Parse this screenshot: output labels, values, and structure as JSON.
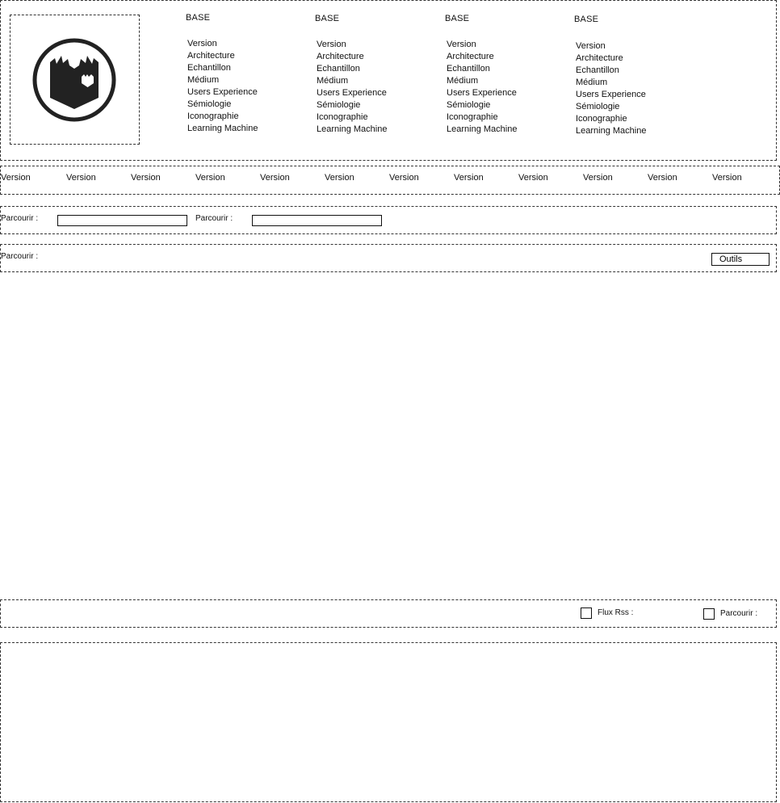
{
  "header": {
    "logo": {
      "icon": "book-shield-logo-icon",
      "color": "#222222"
    },
    "menus": [
      {
        "title": "BASE",
        "items": [
          "Version",
          "Architecture",
          "Echantillon",
          "Médium",
          "Users Experience",
          "Sémiologie",
          "Iconographie",
          "Learning Machine"
        ]
      },
      {
        "title": "BASE",
        "items": [
          "Version",
          "Architecture",
          "Echantillon",
          "Médium",
          "Users Experience",
          "Sémiologie",
          "Iconographie",
          "Learning Machine"
        ]
      },
      {
        "title": "BASE",
        "items": [
          "Version",
          "Architecture",
          "Echantillon",
          "Médium",
          "Users Experience",
          "Sémiologie",
          "Iconographie",
          "Learning Machine"
        ]
      },
      {
        "title": "BASE",
        "items": [
          "Version",
          "Architecture",
          "Echantillon",
          "Médium",
          "Users Experience",
          "Sémiologie",
          "Iconographie",
          "Learning Machine"
        ]
      }
    ]
  },
  "versions_bar": {
    "items": [
      "Version",
      "Version",
      "Version",
      "Version",
      "Version",
      "Version",
      "Version",
      "Version",
      "Version",
      "Version",
      "Version",
      "Version"
    ]
  },
  "browse_row": {
    "label_1": "Parcourir :",
    "input_1_value": "",
    "label_2": "Parcourir :",
    "input_2_value": ""
  },
  "tools_row": {
    "label": "Parcourir :",
    "tools_label": "Outils"
  },
  "footer_bar": {
    "rss_label": "Flux Rss :",
    "browse_label": "Parcourir :"
  },
  "colors": {
    "border": "#333333",
    "text": "#111111",
    "background": "#ffffff"
  }
}
